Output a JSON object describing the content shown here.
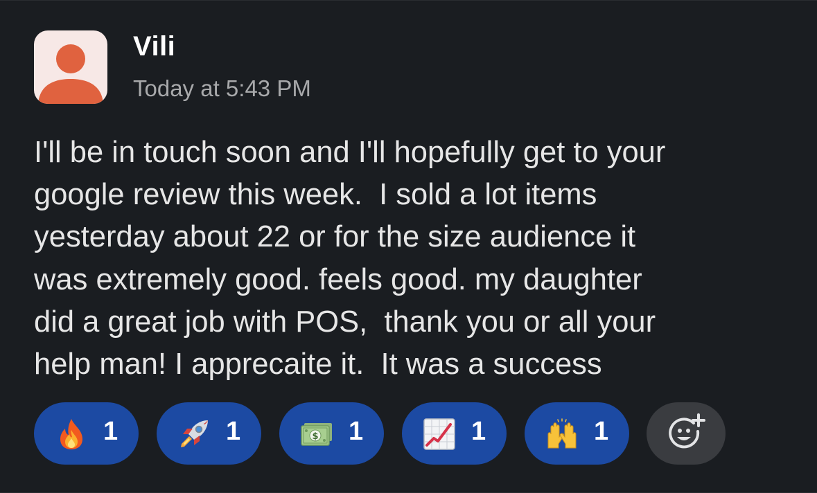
{
  "message": {
    "sender": "Vili",
    "timestamp": "Today at 5:43 PM",
    "lines": [
      "I'll be in touch soon and I'll hopefully get to your",
      "google review this week.  I sold a lot items",
      "yesterday about 22 or for the size audience it",
      "was extremely good. feels good. my daughter",
      "did a great job with POS,  thank you or all your",
      "help man! I apprecaite it.  It was a success"
    ]
  },
  "reactions": [
    {
      "emoji": "fire",
      "count": "1"
    },
    {
      "emoji": "rocket",
      "count": "1"
    },
    {
      "emoji": "dollar-banknote",
      "count": "1"
    },
    {
      "emoji": "chart-increasing",
      "count": "1"
    },
    {
      "emoji": "raising-hands",
      "count": "1"
    }
  ],
  "add_reaction": {
    "icon": "add-emoji-icon"
  },
  "colors": {
    "background": "#1a1d21",
    "reaction_bg": "#1c4aa3",
    "avatar_bg": "#f7e8e6",
    "avatar_figure": "#e0623f"
  }
}
